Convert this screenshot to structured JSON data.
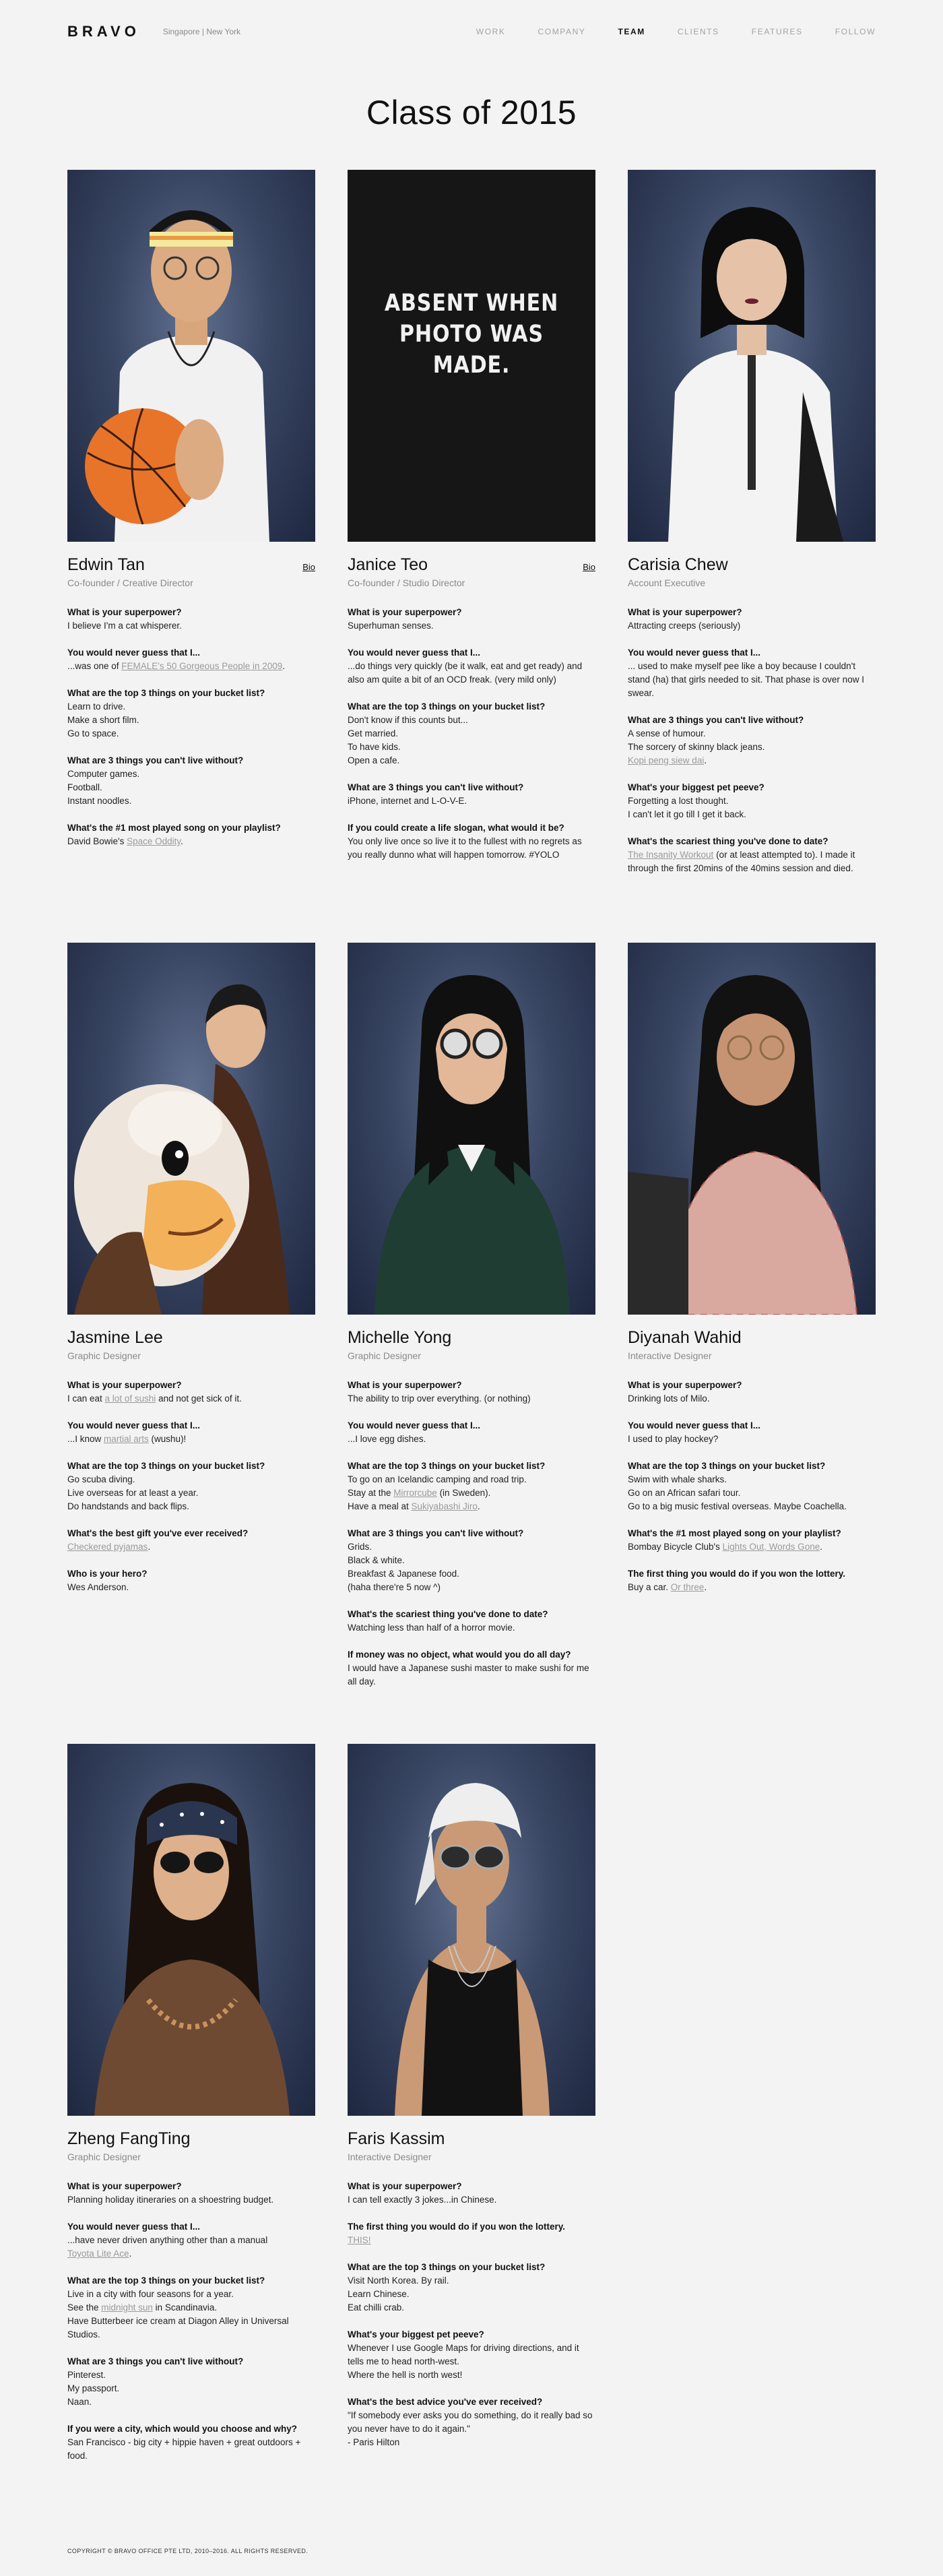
{
  "header": {
    "logo": "BRAVO",
    "location": "Singapore | New York",
    "nav": [
      "WORK",
      "COMPANY",
      "TEAM",
      "CLIENTS",
      "FEATURES",
      "FOLLOW"
    ]
  },
  "page": {
    "title": "Class of 2015"
  },
  "members": [
    {
      "name": "Edwin Tan",
      "role": "Co-founder / Creative Director",
      "bio": "Bio",
      "qa": [
        {
          "q": "What is your superpower?",
          "a": [
            "I believe I'm a cat whisperer."
          ]
        },
        {
          "q": "You would never guess that I...",
          "a": [
            [
              "...was one of ",
              {
                "link": "FEMALE's 50 Gorgeous People in 2009"
              },
              "."
            ]
          ]
        },
        {
          "q": "What are the top 3 things on your bucket list?",
          "a": [
            "Learn to drive.",
            "Make a short film.",
            "Go to space."
          ]
        },
        {
          "q": "What are 3 things you can't live without?",
          "a": [
            "Computer games.",
            "Football.",
            "Instant noodles."
          ]
        },
        {
          "q": "What's the #1 most played song on your playlist?",
          "a": [
            [
              "David Bowie's ",
              {
                "link": "Space Oddity"
              },
              "."
            ]
          ]
        }
      ]
    },
    {
      "name": "Janice Teo",
      "role": "Co-founder / Studio Director",
      "bio": "Bio",
      "absent": "ABSENT WHEN PHOTO WAS MADE.",
      "qa": [
        {
          "q": "What is your superpower?",
          "a": [
            "Superhuman senses."
          ]
        },
        {
          "q": "You would never guess that I...",
          "a": [
            "...do things very quickly (be it walk, eat and get ready) and also am quite a bit of an OCD freak. (very mild only)"
          ]
        },
        {
          "q": "What are the top 3 things on your bucket list?",
          "a": [
            "Don't know if this counts but...",
            "Get married.",
            "To have kids.",
            "Open a cafe."
          ]
        },
        {
          "q": "What are 3 things you can't live without?",
          "a": [
            "iPhone, internet and L-O-V-E."
          ]
        },
        {
          "q": "If you could create a life slogan, what would it be?",
          "a": [
            "You only live once so live it to the fullest with no regrets as you really dunno what will happen tomorrow. #YOLO"
          ]
        }
      ]
    },
    {
      "name": "Carisia Chew",
      "role": "Account Executive",
      "qa": [
        {
          "q": "What is your superpower?",
          "a": [
            "Attracting creeps (seriously)"
          ]
        },
        {
          "q": "You would never guess that I...",
          "a": [
            "... used to make myself pee like a boy because I couldn't stand (ha) that girls needed to sit. That phase is over now I swear."
          ]
        },
        {
          "q": "What are 3 things you can't live without?",
          "a": [
            "A sense of humour.",
            "The sorcery of skinny black jeans.",
            [
              {
                "link": "Kopi peng siew dai"
              },
              "."
            ]
          ]
        },
        {
          "q": "What's your biggest pet peeve?",
          "a": [
            "Forgetting a lost thought.",
            "I can't let it go till I get it back."
          ]
        },
        {
          "q": "What's the scariest thing you've done to date?",
          "a": [
            [
              {
                "link": "The Insanity Workout"
              },
              " (or at least attempted to). I made it through the first 20mins of the 40mins session and died."
            ]
          ]
        }
      ]
    },
    {
      "name": "Jasmine Lee",
      "role": "Graphic Designer",
      "qa": [
        {
          "q": "What is your superpower?",
          "a": [
            [
              "I can eat ",
              {
                "link": "a lot of sushi"
              },
              " and not get sick of it."
            ]
          ]
        },
        {
          "q": "You would never guess that I...",
          "a": [
            [
              "...I know ",
              {
                "link": "martial arts"
              },
              " (wushu)!"
            ]
          ]
        },
        {
          "q": "What are the top 3 things on your bucket list?",
          "a": [
            "Go scuba diving.",
            "Live overseas for at least a year.",
            "Do handstands and back flips."
          ]
        },
        {
          "q": "What's the best gift you've ever received?",
          "a": [
            [
              {
                "link": "Checkered pyjamas"
              },
              "."
            ]
          ]
        },
        {
          "q": "Who is your hero?",
          "a": [
            "Wes Anderson."
          ]
        }
      ]
    },
    {
      "name": "Michelle Yong",
      "role": "Graphic Designer",
      "qa": [
        {
          "q": "What is your superpower?",
          "a": [
            "The ability to trip over everything. (or nothing)"
          ]
        },
        {
          "q": "You would never guess that I...",
          "a": [
            "...I love egg dishes."
          ]
        },
        {
          "q": "What are the top 3 things on your bucket list?",
          "a": [
            "To go on an Icelandic camping and road trip.",
            [
              "Stay at the ",
              {
                "link": "Mirrorcube"
              },
              " (in Sweden)."
            ],
            [
              "Have a meal at ",
              {
                "link": "Sukiyabashi Jiro"
              },
              "."
            ]
          ]
        },
        {
          "q": "What are 3 things you can't live without?",
          "a": [
            "Grids.",
            "Black & white.",
            "Breakfast & Japanese food.",
            "(haha there're 5 now ^)"
          ]
        },
        {
          "q": "What's the scariest thing you've done to date?",
          "a": [
            "Watching less than half of a horror movie."
          ]
        },
        {
          "q": "If money was no object, what would you do all day?",
          "a": [
            "I would have a Japanese sushi master to make sushi for me all day."
          ]
        }
      ]
    },
    {
      "name": "Diyanah Wahid",
      "role": "Interactive Designer",
      "qa": [
        {
          "q": "What is your superpower?",
          "a": [
            "Drinking lots of Milo."
          ]
        },
        {
          "q": "You would never guess that I...",
          "a": [
            "I used to play hockey?"
          ]
        },
        {
          "q": "What are the top 3 things on your bucket list?",
          "a": [
            "Swim with whale sharks.",
            "Go on an African safari tour.",
            "Go to a big music festival overseas. Maybe Coachella."
          ]
        },
        {
          "q": "What's the #1 most played song on your playlist?",
          "a": [
            [
              "Bombay Bicycle Club's ",
              {
                "link": "Lights Out, Words Gone"
              },
              "."
            ]
          ]
        },
        {
          "q": "The first thing you would do if you won the lottery.",
          "a": [
            [
              "Buy a car. ",
              {
                "link": "Or three"
              },
              "."
            ]
          ]
        }
      ]
    },
    {
      "name": "Zheng FangTing",
      "role": "Graphic Designer",
      "qa": [
        {
          "q": "What is your superpower?",
          "a": [
            "Planning holiday itineraries on a shoestring budget."
          ]
        },
        {
          "q": "You would never guess that I...",
          "a": [
            "...have never driven anything other than a manual",
            [
              {
                "link": "Toyota Lite Ace"
              },
              "."
            ]
          ]
        },
        {
          "q": "What are the top 3 things on your bucket list?",
          "a": [
            "Live in a city with four seasons for a year.",
            [
              "See the ",
              {
                "link": "midnight sun"
              },
              " in Scandinavia."
            ],
            "Have Butterbeer ice cream at Diagon Alley in Universal Studios."
          ]
        },
        {
          "q": "What are 3 things you can't live without?",
          "a": [
            "Pinterest.",
            "My passport.",
            "Naan."
          ]
        },
        {
          "q": "If you were a city, which would you choose and why?",
          "a": [
            "San Francisco - big city + hippie haven + great outdoors + food."
          ]
        }
      ]
    },
    {
      "name": "Faris Kassim",
      "role": "Interactive Designer",
      "qa": [
        {
          "q": "What is your superpower?",
          "a": [
            "I can tell exactly 3 jokes...in Chinese."
          ]
        },
        {
          "q": "The first thing you would do if you won the lottery.",
          "a": [
            [
              {
                "link": "THIS!"
              }
            ]
          ]
        },
        {
          "q": "What are the top 3 things on your bucket list?",
          "a": [
            "Visit North Korea. By rail.",
            "Learn Chinese.",
            "Eat chilli crab."
          ]
        },
        {
          "q": "What's your biggest pet peeve?",
          "a": [
            "Whenever I use Google Maps for driving directions, and it tells me to head north-west.",
            "Where the hell is north west!"
          ]
        },
        {
          "q": "What's the best advice you've ever received?",
          "a": [
            "\"If somebody ever asks you do something, do it really bad so you never have to do it again.\"",
            "- Paris Hilton"
          ]
        }
      ]
    }
  ],
  "footer": {
    "copyright": "COPYRIGHT © BRAVO OFFICE PTE LTD, 2010–2016. ALL RIGHTS RESERVED."
  },
  "colors": {
    "background": "#f3f3f3",
    "text": "#1b1b1b",
    "muted": "#8a8a8a",
    "link": "#9a9a9a",
    "photo_backdrop": "#394764"
  }
}
